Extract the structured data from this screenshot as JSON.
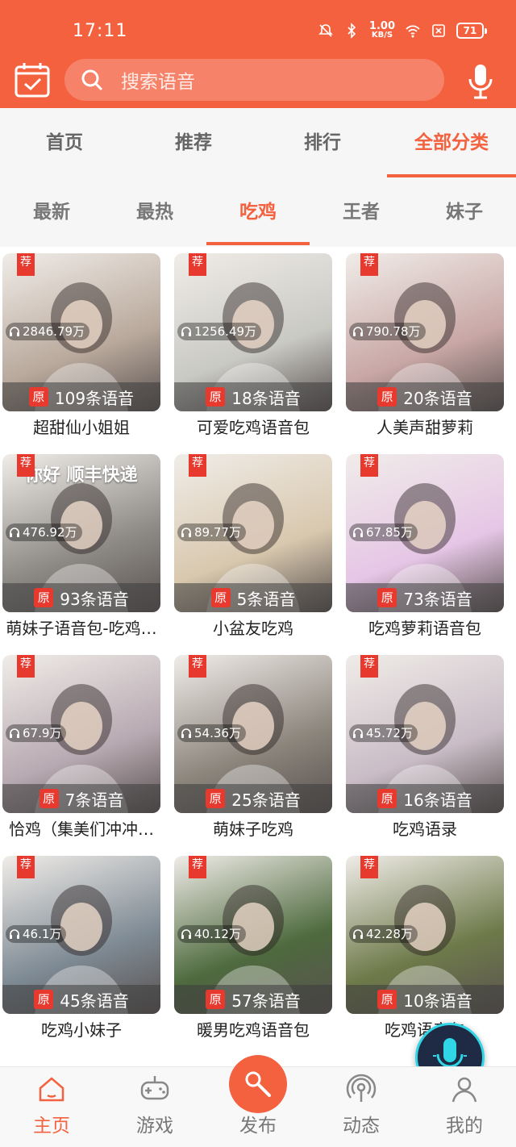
{
  "status_bar": {
    "time": "17:11",
    "net_speed": "1.00",
    "net_unit": "KB/S",
    "battery": "71"
  },
  "search": {
    "placeholder": "搜索语音"
  },
  "main_tabs": [
    {
      "label": "首页",
      "active": false
    },
    {
      "label": "推荐",
      "active": false
    },
    {
      "label": "排行",
      "active": false
    },
    {
      "label": "全部分类",
      "active": true
    }
  ],
  "sub_tabs": [
    {
      "label": "最新",
      "active": false
    },
    {
      "label": "最热",
      "active": false
    },
    {
      "label": "吃鸡",
      "active": true
    },
    {
      "label": "王者",
      "active": false
    },
    {
      "label": "妹子",
      "active": false
    }
  ],
  "badges": {
    "recommend": "荐",
    "original": "原"
  },
  "cards": [
    {
      "title": "超甜仙小姐姐",
      "plays": "2846.79万",
      "count": "109条语音",
      "thumb_color": "#b9a99c"
    },
    {
      "title": "可爱吃鸡语音包",
      "plays": "1256.49万",
      "count": "18条语音",
      "thumb_color": "#c9c9c4"
    },
    {
      "title": "人美声甜萝莉",
      "plays": "790.78万",
      "count": "20条语音",
      "thumb_color": "#c8a7a5"
    },
    {
      "title": "萌妹子语音包-吃鸡…",
      "plays": "476.92万",
      "count": "93条语音",
      "thumb_color": "#8d8a86",
      "overlay_text": "你好 顺丰快递"
    },
    {
      "title": "小盆友吃鸡",
      "plays": "89.77万",
      "count": "5条语音",
      "thumb_color": "#d8c8ae"
    },
    {
      "title": "吃鸡萝莉语音包",
      "plays": "67.85万",
      "count": "73条语音",
      "thumb_color": "#e6c6e6"
    },
    {
      "title": "恰鸡（集美们冲冲…",
      "plays": "67.9万",
      "count": "7条语音",
      "thumb_color": "#b7a9b1"
    },
    {
      "title": "萌妹子吃鸡",
      "plays": "54.36万",
      "count": "25条语音",
      "thumb_color": "#8b857c"
    },
    {
      "title": "吃鸡语录",
      "plays": "45.72万",
      "count": "16条语音",
      "thumb_color": "#c9bcc6"
    },
    {
      "title": "吃鸡小妹子",
      "plays": "46.1万",
      "count": "45条语音",
      "thumb_color": "#7e8a94"
    },
    {
      "title": "暖男吃鸡语音包",
      "plays": "40.12万",
      "count": "57条语音",
      "thumb_color": "#4e6a3e"
    },
    {
      "title": "吃鸡语音包",
      "plays": "42.28万",
      "count": "10条语音",
      "thumb_color": "#6e7a4a"
    }
  ],
  "bottom_nav": [
    {
      "label": "主页",
      "active": true
    },
    {
      "label": "游戏",
      "active": false
    },
    {
      "label": "发布",
      "active": false
    },
    {
      "label": "动态",
      "active": false
    },
    {
      "label": "我的",
      "active": false
    }
  ],
  "icons": {
    "calendar": "calendar-check-icon",
    "search": "search-icon",
    "mic": "microphone-icon",
    "headphones": "headphones-icon",
    "home": "home-icon",
    "game": "gamepad-icon",
    "publish": "microphone-publish-icon",
    "feed": "broadcast-icon",
    "profile": "person-icon"
  },
  "colors": {
    "brand": "#f4613f",
    "badge_red": "#e8392f",
    "tab_inactive": "#666666"
  }
}
